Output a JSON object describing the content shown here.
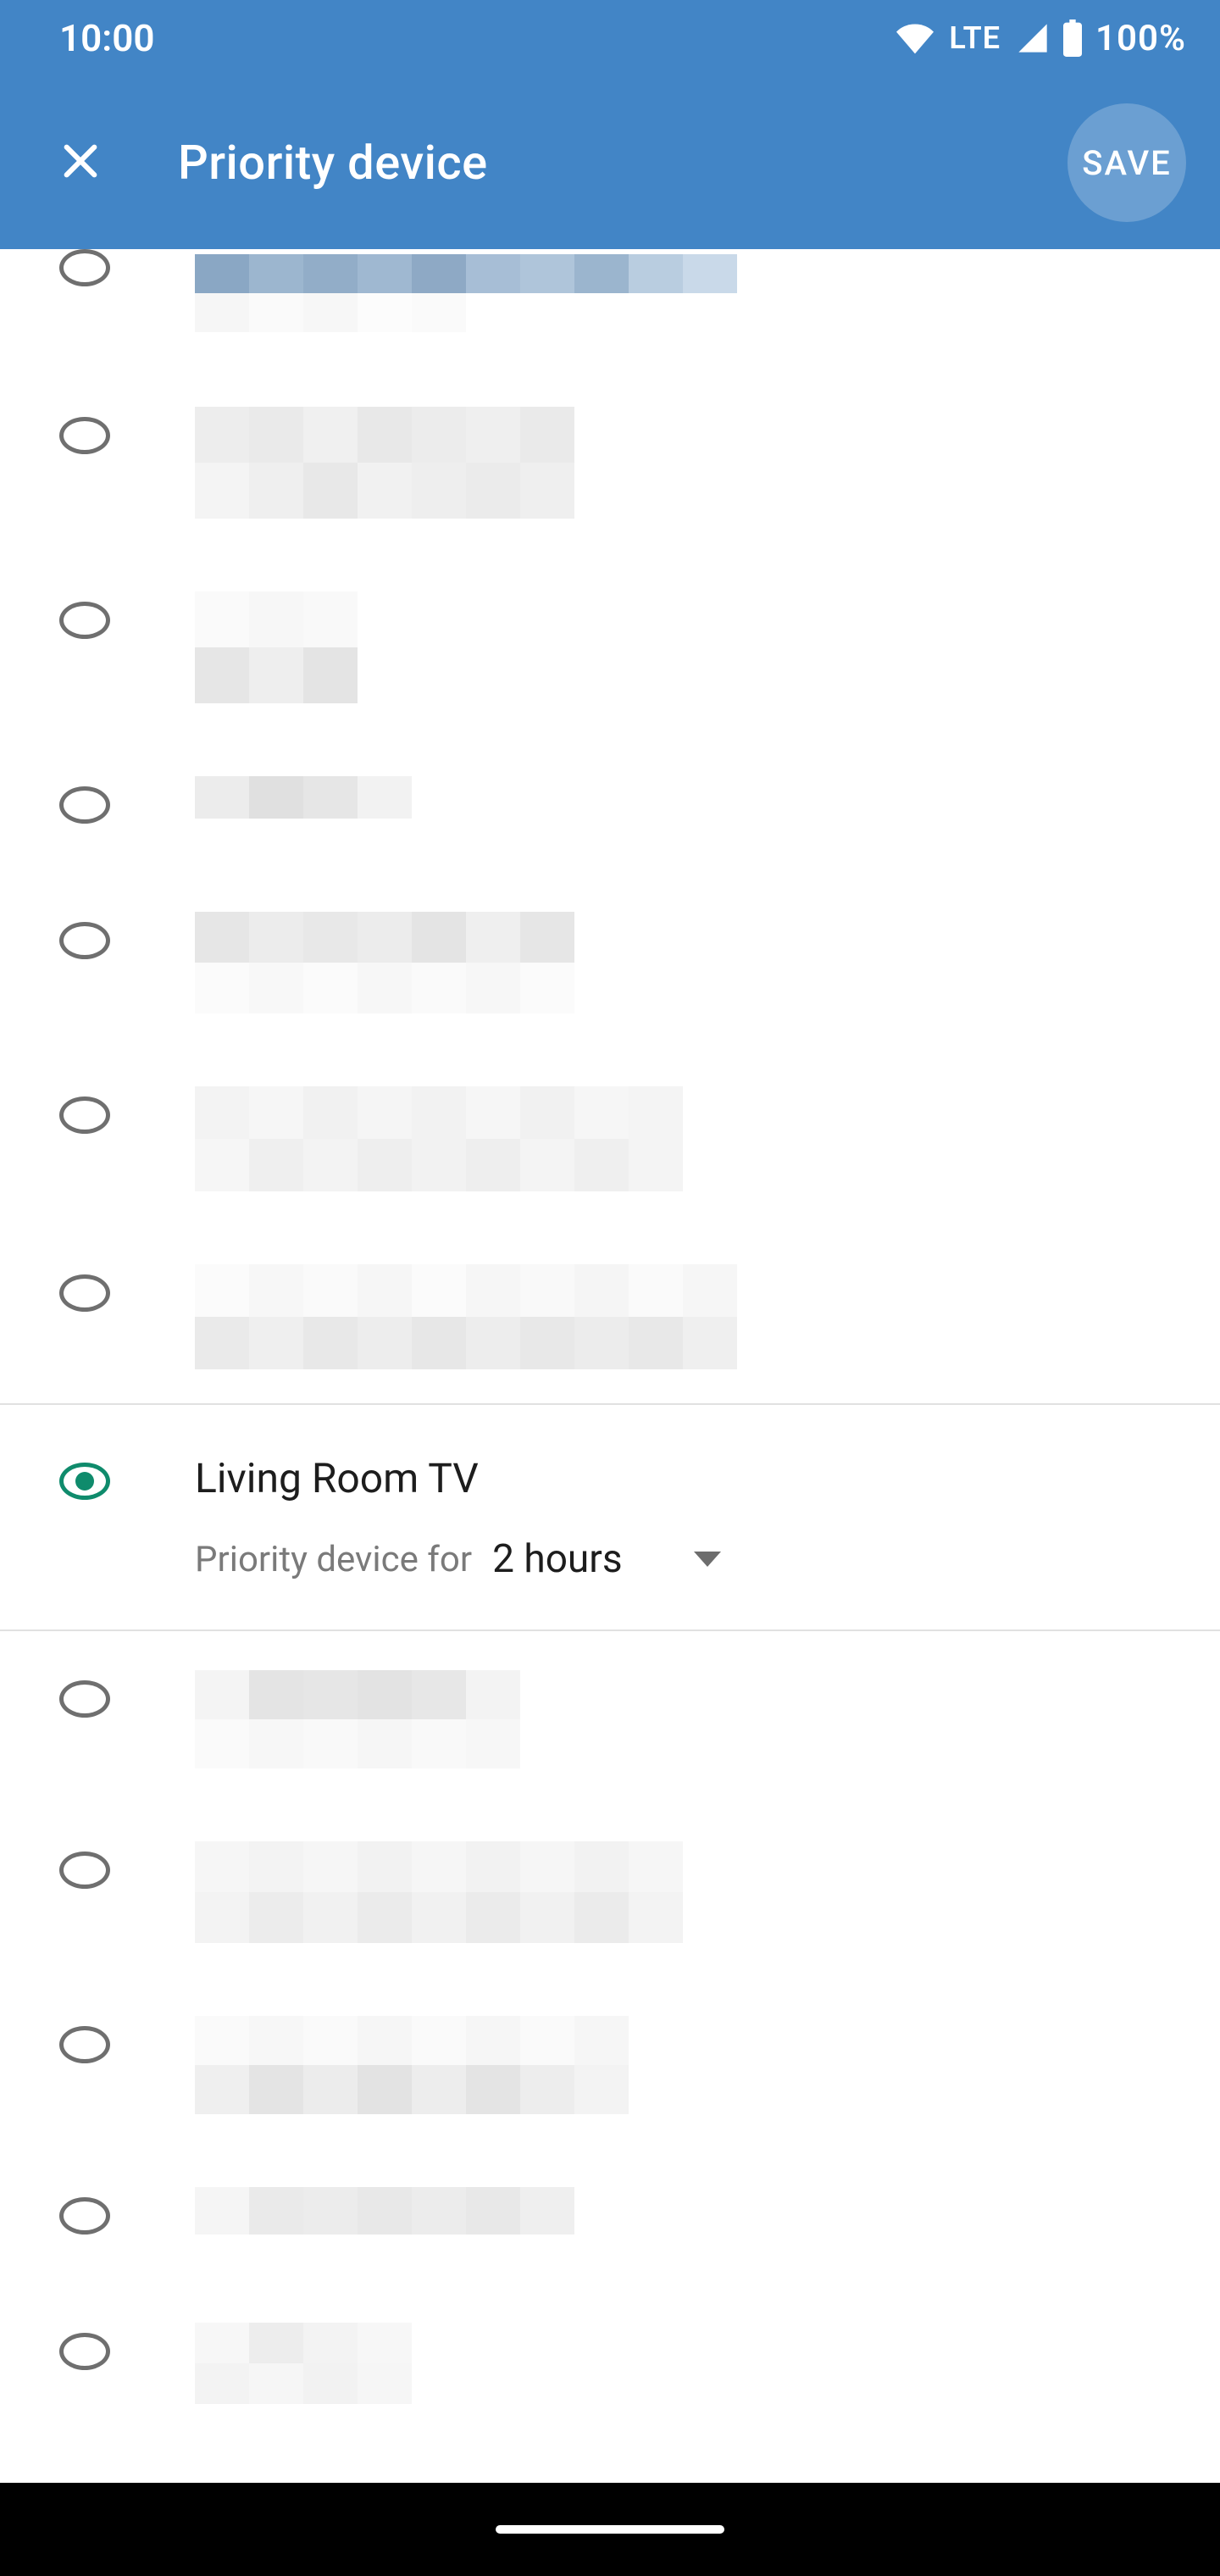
{
  "status": {
    "time": "10:00",
    "network_label": "LTE",
    "battery_pct": "100%"
  },
  "appbar": {
    "title": "Priority device",
    "save_label": "SAVE"
  },
  "selected": {
    "name": "Living Room TV",
    "caption": "Priority device for",
    "duration": "2 hours"
  },
  "colors": {
    "header_bg": "#4285c6",
    "radio_selected": "#0f8b6c"
  }
}
